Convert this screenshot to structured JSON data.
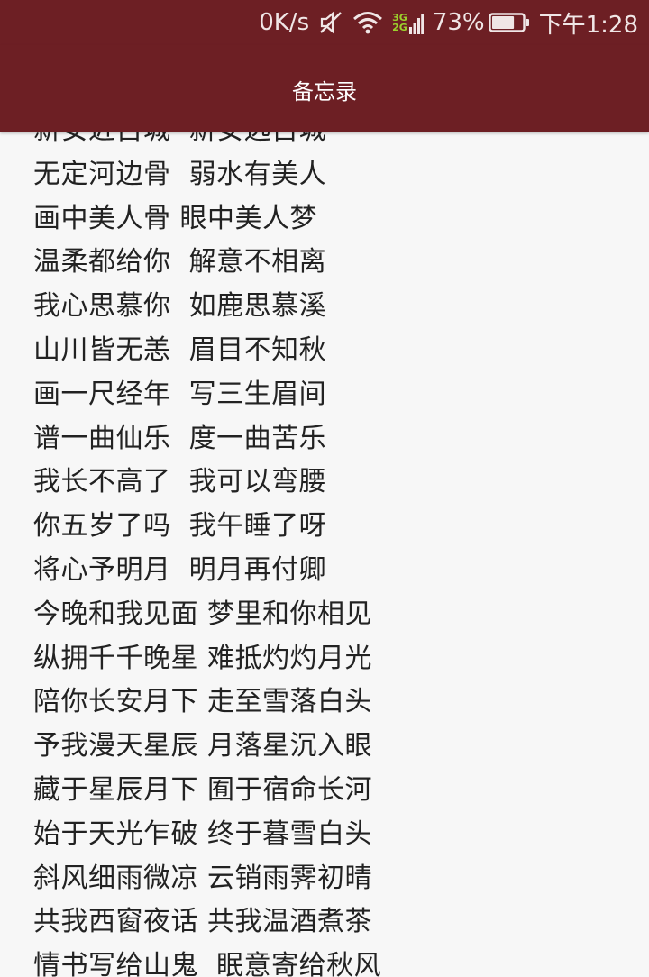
{
  "status_bar": {
    "net_speed": "0K/s",
    "net_types": [
      "3G",
      "2G"
    ],
    "battery_percent": "73%",
    "time": "下午1:28",
    "icons": [
      "mute-icon",
      "wifi-icon",
      "signal-icon",
      "battery-icon"
    ],
    "battery_level": 0.73
  },
  "app_bar": {
    "title": "备忘录"
  },
  "colors": {
    "bar_bg": "#6d1f24",
    "page_bg": "#f7f7f7",
    "text": "#222222"
  },
  "note": {
    "lines": [
      "新安近古城  新安远古城",
      "无定河边骨  弱水有美人",
      "画中美人骨 眼中美人梦",
      "温柔都给你  解意不相离",
      "我心思慕你  如鹿思慕溪",
      "山川皆无恙  眉目不知秋",
      "画一尺经年  写三生眉间",
      "谱一曲仙乐  度一曲苦乐",
      "我长不高了  我可以弯腰",
      "你五岁了吗  我午睡了呀",
      "将心予明月  明月再付卿",
      "今晚和我见面 梦里和你相见",
      "纵拥千千晚星 难抵灼灼月光",
      "陪你长安月下 走至雪落白头",
      "予我漫天星辰 月落星沉入眼",
      "藏于星辰月下 囿于宿命长河",
      "始于天光乍破 终于暮雪白头",
      "斜风细雨微凉 云销雨霁初晴",
      "共我西窗夜话 共我温酒煮茶",
      "情书写给山鬼  眠意寄给秋风"
    ]
  }
}
